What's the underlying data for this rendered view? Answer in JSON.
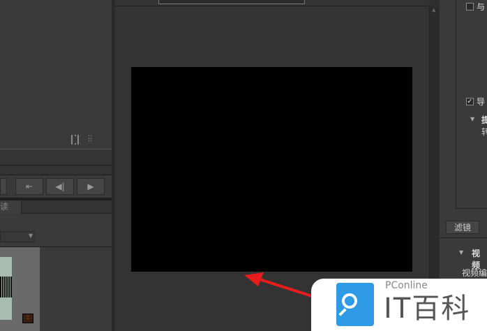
{
  "left_panel": {
    "tab_label": "读"
  },
  "right_panel": {
    "checkbox1_label": "与",
    "checkbox1_checked": false,
    "checkbox2_label": "导",
    "checkbox2_checked": true,
    "section1_label": "提",
    "section1_sub": "转",
    "filter_button": "滤镜",
    "section2_label": "视频",
    "section2_sub": "视频编"
  },
  "watermark": {
    "brand": "PConline",
    "name": "IT百科",
    "accent": "#2f9ae6"
  },
  "colors": {
    "arrow": "#e81c1c"
  }
}
